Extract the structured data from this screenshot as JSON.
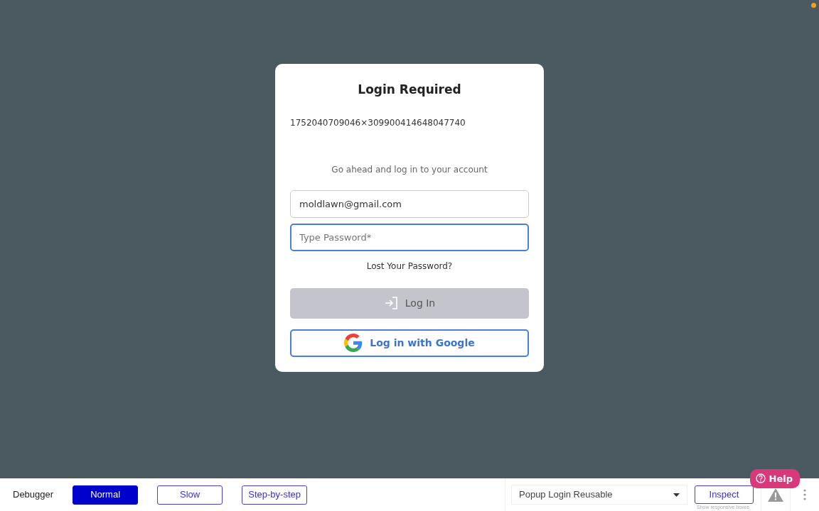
{
  "login": {
    "title": "Login Required",
    "code": "1752040709046×309900414648047740",
    "subtitle": "Go ahead and log in to your account",
    "email": {
      "value": "moldlawn@gmail.com",
      "focused": false
    },
    "password": {
      "placeholder": "Type Password*",
      "focused": true
    },
    "lost_password": "Lost Your Password?",
    "login_button": {
      "label": "Log In",
      "disabled": true
    },
    "google_button": {
      "label": "Log in with Google"
    }
  },
  "help_button": "Help",
  "debugger": {
    "label": "Debugger",
    "modes": [
      {
        "label": "Normal",
        "selected": true
      },
      {
        "label": "Slow",
        "selected": false
      },
      {
        "label": "Step-by-step",
        "selected": false
      }
    ],
    "page_select": "Popup Login Reusable",
    "inspect_button": "Inspect",
    "inspect_hint": "Show responsive boxes"
  }
}
